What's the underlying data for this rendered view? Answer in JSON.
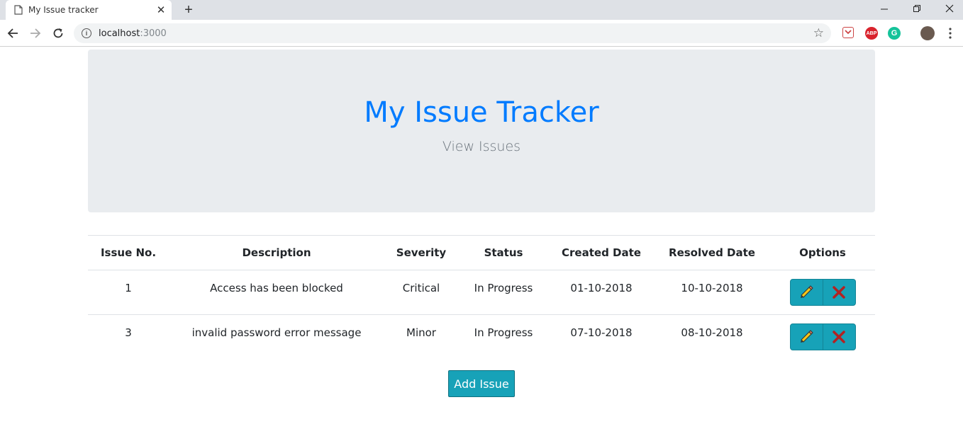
{
  "browser": {
    "tab_title": "My Issue tracker",
    "url_host": "localhost",
    "url_port": ":3000"
  },
  "header": {
    "title": "My Issue Tracker",
    "subtitle": "View Issues"
  },
  "table": {
    "columns": [
      "Issue No.",
      "Description",
      "Severity",
      "Status",
      "Created Date",
      "Resolved Date",
      "Options"
    ],
    "rows": [
      {
        "issue_no": "1",
        "description": "Access has been blocked",
        "severity": "Critical",
        "status": "In Progress",
        "created": "01-10-2018",
        "resolved": "10-10-2018"
      },
      {
        "issue_no": "3",
        "description": "invalid password error message",
        "severity": "Minor",
        "status": "In Progress",
        "created": "07-10-2018",
        "resolved": "08-10-2018"
      }
    ]
  },
  "actions": {
    "add_label": "Add Issue"
  },
  "colors": {
    "accent": "#007bff",
    "info": "#17a2b8",
    "jumbotron_bg": "#e9ecef"
  }
}
